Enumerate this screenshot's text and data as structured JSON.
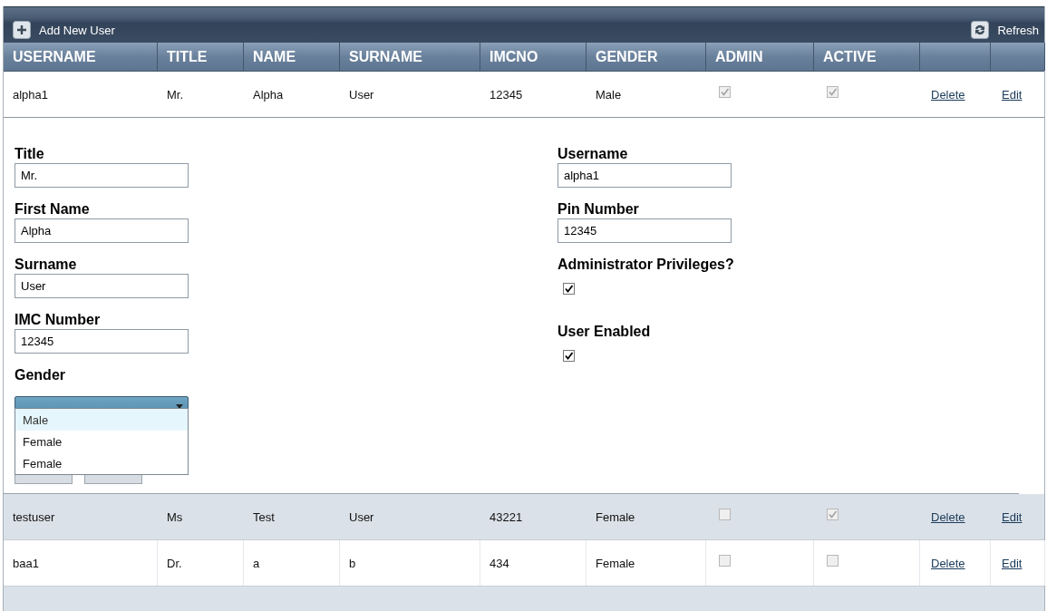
{
  "toolbar": {
    "add_label": "Add New User",
    "refresh_label": "Refresh"
  },
  "columns": [
    "USERNAME",
    "TITLE",
    "NAME",
    "SURNAME",
    "IMCNO",
    "GENDER",
    "ADMIN",
    "ACTIVE"
  ],
  "rows": [
    {
      "username": "alpha1",
      "title": "Mr.",
      "name": "Alpha",
      "surname": "User",
      "imcno": "12345",
      "gender": "Male",
      "admin": true,
      "active": true,
      "delete": "Delete",
      "edit": "Edit",
      "editing": true,
      "shaded": false
    },
    {
      "username": "testuser",
      "title": "Ms",
      "name": "Test",
      "surname": "User",
      "imcno": "43221",
      "gender": "Female",
      "admin": false,
      "active": true,
      "delete": "Delete",
      "edit": "Edit",
      "editing": false,
      "shaded": true
    },
    {
      "username": "baa1",
      "title": "Dr.",
      "name": "a",
      "surname": "b",
      "imcno": "434",
      "gender": "Female",
      "admin": false,
      "active": false,
      "delete": "Delete",
      "edit": "Edit",
      "editing": false,
      "shaded": false
    }
  ],
  "edit_form": {
    "left": [
      {
        "kind": "input",
        "label": "Title",
        "value": "Mr."
      },
      {
        "kind": "input",
        "label": "First Name",
        "value": "Alpha"
      },
      {
        "kind": "input",
        "label": "Surname",
        "value": "User"
      },
      {
        "kind": "input",
        "label": "IMC Number",
        "value": "12345"
      },
      {
        "kind": "select",
        "label": "Gender",
        "expanded": true,
        "options": [
          {
            "label": "Male",
            "selected": true
          },
          {
            "label": "Female",
            "selected": false
          },
          {
            "label": "Female",
            "selected": false
          }
        ]
      }
    ],
    "right": [
      {
        "kind": "input",
        "label": "Username",
        "value": "alpha1"
      },
      {
        "kind": "input",
        "label": "Pin Number",
        "value": "12345"
      },
      {
        "kind": "checkbox",
        "label": "Administrator Privileges?",
        "checked": true
      },
      {
        "kind": "checkbox",
        "label": "User Enabled",
        "checked": true
      }
    ]
  }
}
